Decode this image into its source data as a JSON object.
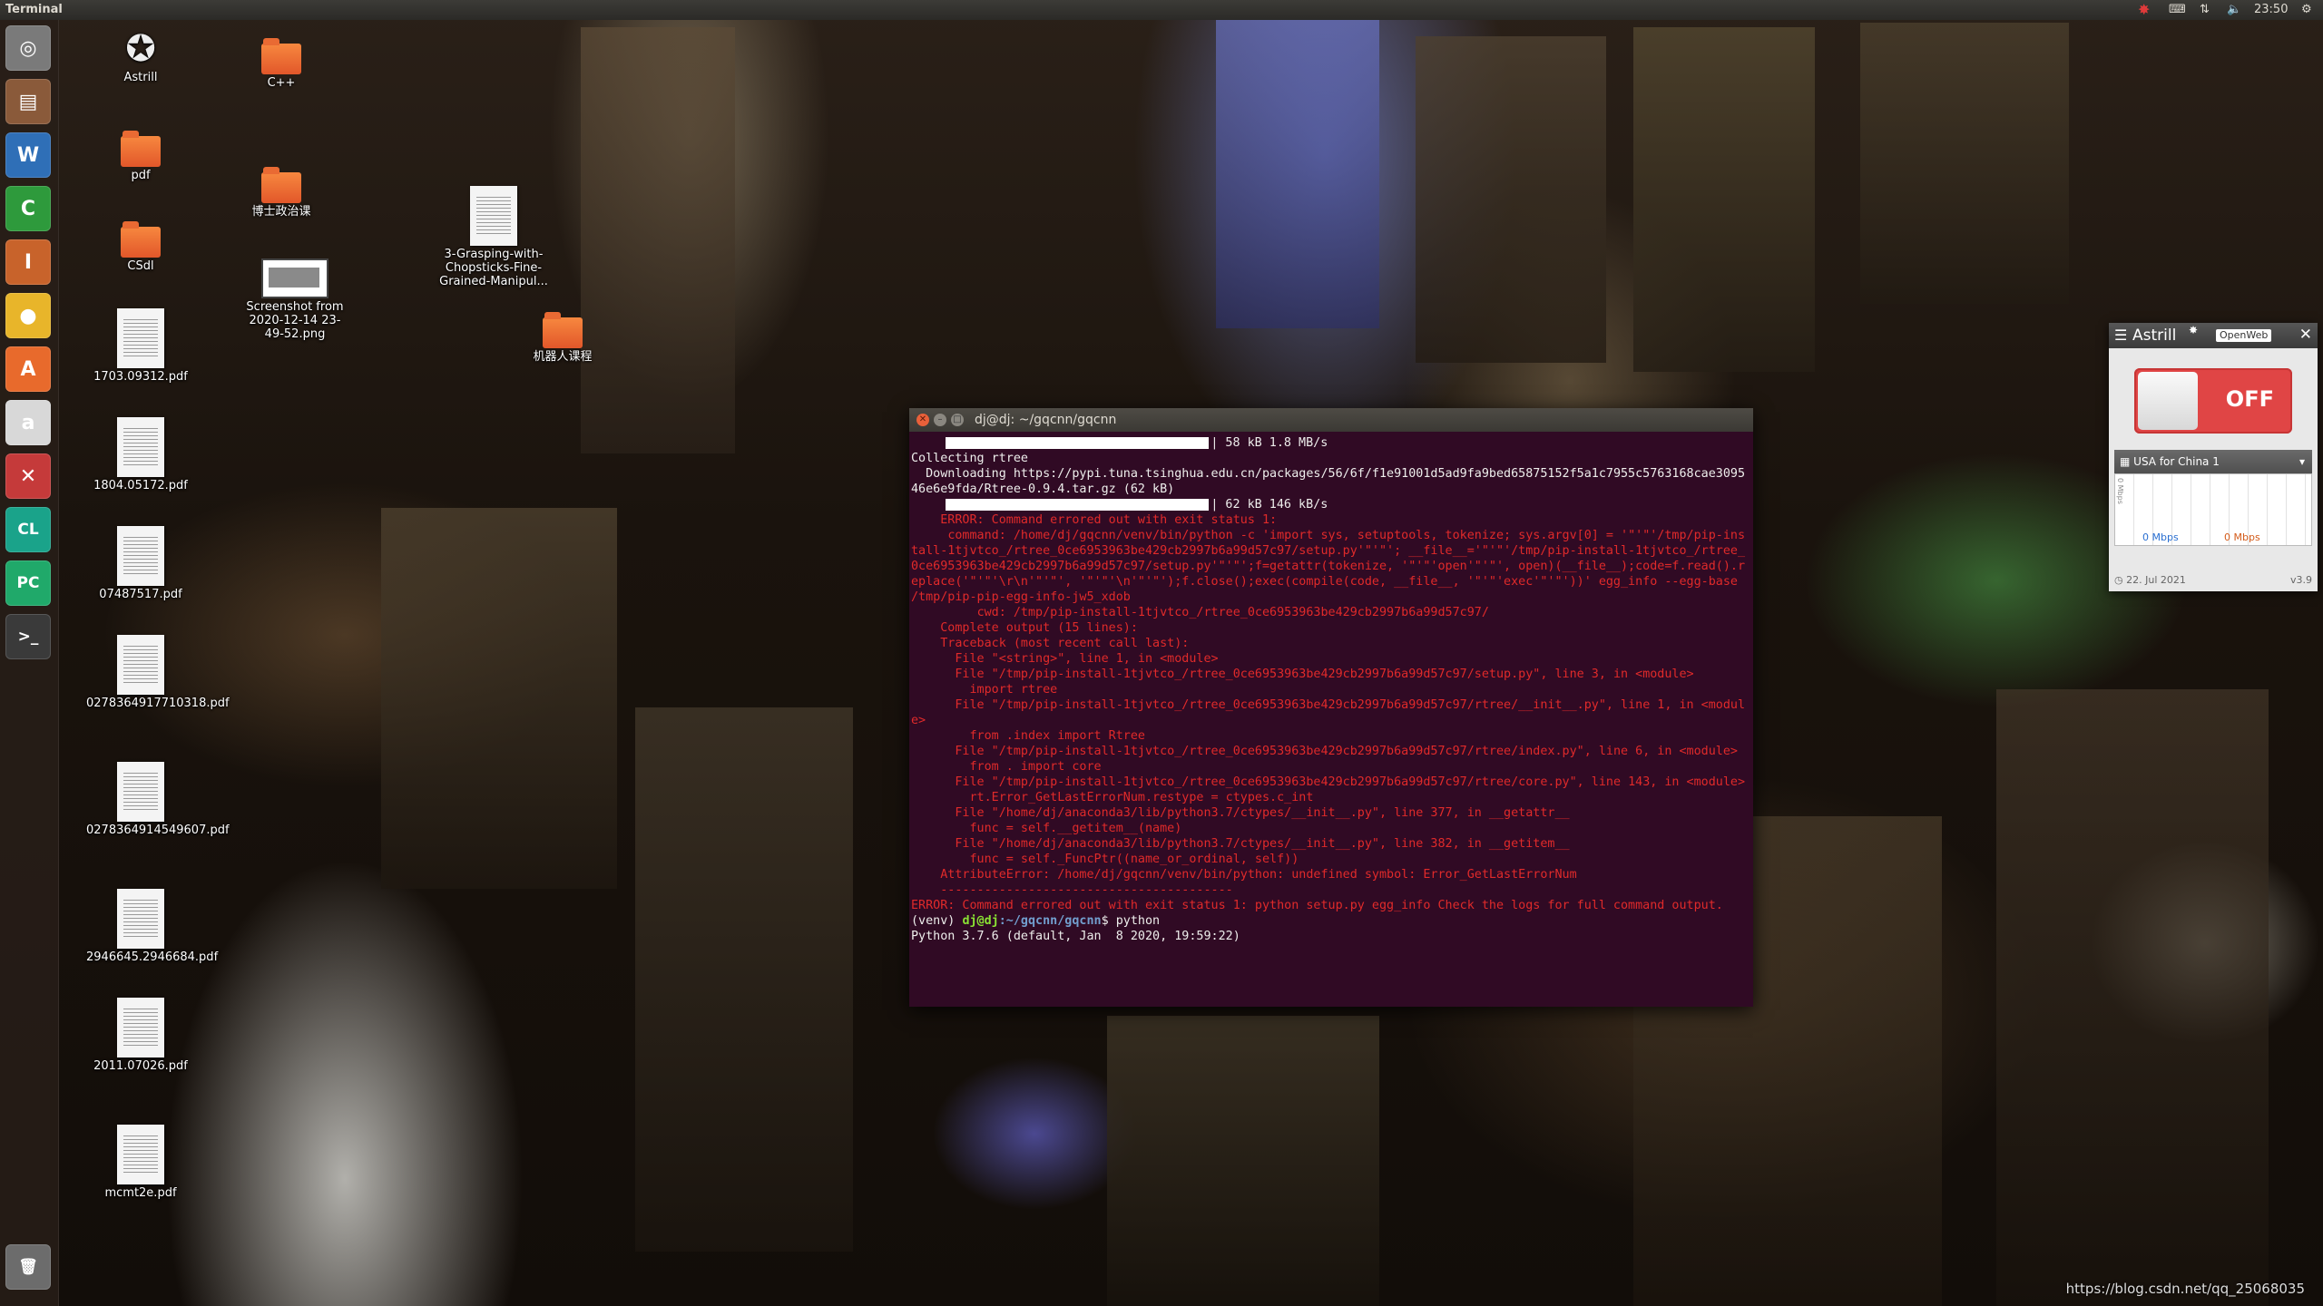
{
  "top_panel": {
    "title": "Terminal",
    "clock": "23:50",
    "tray_icons": [
      "astrill-tray-icon",
      "keyboard-icon",
      "network-icon",
      "volume-icon",
      "settings-gear-icon"
    ]
  },
  "launcher": {
    "items": [
      {
        "name": "ubuntu-dash-icon",
        "glyph": "◎",
        "color": "#7a7a7a"
      },
      {
        "name": "files-icon",
        "glyph": "▤",
        "color": "#8a5a3a"
      },
      {
        "name": "writer-icon",
        "glyph": "W",
        "color": "#2f6fb7"
      },
      {
        "name": "calc-icon",
        "glyph": "C",
        "color": "#2e9a3c"
      },
      {
        "name": "impress-icon",
        "glyph": "I",
        "color": "#c8632b"
      },
      {
        "name": "chrome-icon",
        "glyph": "●",
        "color": "#e8b52a"
      },
      {
        "name": "software-center-icon",
        "glyph": "A",
        "color": "#e86a2c"
      },
      {
        "name": "amazon-icon",
        "glyph": "a",
        "color": "#d8d8d8"
      },
      {
        "name": "system-settings-icon",
        "glyph": "✕",
        "color": "#c53a3a"
      },
      {
        "name": "clion-icon",
        "glyph": "CL",
        "color": "#1aa38a"
      },
      {
        "name": "pycharm-icon",
        "glyph": "PC",
        "color": "#20a96a"
      },
      {
        "name": "terminal-icon",
        "glyph": ">_",
        "color": "#3a3a3a"
      },
      {
        "name": "trash-icon",
        "glyph": "🗑",
        "color": "#6c6c6c"
      }
    ]
  },
  "desktop_icons": [
    {
      "name": "astrill-desktop-icon",
      "type": "astrill",
      "label": "Astrill"
    },
    {
      "name": "folder-cpp",
      "type": "folder",
      "label": "C++"
    },
    {
      "name": "folder-pdf",
      "type": "folder",
      "label": "pdf"
    },
    {
      "name": "folder-politics",
      "type": "folder",
      "label": "博士政治课"
    },
    {
      "name": "folder-csdl",
      "type": "folder",
      "label": "CSdl"
    },
    {
      "name": "screenshot-file",
      "type": "shot",
      "label": "Screenshot from 2020-12-14 23-49-52.png"
    },
    {
      "name": "grasping-file",
      "type": "doc",
      "label": "3-Grasping-with-Chopsticks-Fine-Grained-Manipul..."
    },
    {
      "name": "folder-robot",
      "type": "folder",
      "label": "机器人课程"
    },
    {
      "name": "pdf-1703",
      "type": "doc",
      "label": "1703.09312.pdf"
    },
    {
      "name": "pdf-1804",
      "type": "doc",
      "label": "1804.05172.pdf"
    },
    {
      "name": "pdf-07487",
      "type": "doc",
      "label": "07487517.pdf"
    },
    {
      "name": "pdf-0278-1",
      "type": "doc",
      "label": "0278364917710318.pdf"
    },
    {
      "name": "pdf-0278-2",
      "type": "doc",
      "label": "0278364914549607.pdf"
    },
    {
      "name": "pdf-2946",
      "type": "doc",
      "label": "2946645.2946684.pdf"
    },
    {
      "name": "pdf-2011",
      "type": "doc",
      "label": "2011.07026.pdf"
    },
    {
      "name": "pdf-mcmt",
      "type": "doc",
      "label": "mcmt2e.pdf"
    }
  ],
  "terminal": {
    "title": "dj@dj: ~/gqcnn/gqcnn",
    "lines": [
      {
        "bar": true,
        "text": "| 58 kB 1.8 MB/s",
        "style": "normal"
      },
      {
        "text": "Collecting rtree",
        "style": "normal"
      },
      {
        "text": "  Downloading https://pypi.tuna.tsinghua.edu.cn/packages/56/6f/f1e91001d5ad9fa9bed65875152f5a1c7955c5763168cae309546e6e9fda/Rtree-0.9.4.tar.gz (62 kB)",
        "style": "normal"
      },
      {
        "bar": true,
        "text": "| 62 kB 146 kB/s",
        "style": "normal"
      },
      {
        "text": "    ERROR: Command errored out with exit status 1:",
        "style": "err"
      },
      {
        "text": "     command: /home/dj/gqcnn/venv/bin/python -c 'import sys, setuptools, tokenize; sys.argv[0] = '\"'\"'/tmp/pip-install-1tjvtco_/rtree_0ce6953963be429cb2997b6a99d57c97/setup.py'\"'\"'; __file__='\"'\"'/tmp/pip-install-1tjvtco_/rtree_0ce6953963be429cb2997b6a99d57c97/setup.py'\"'\"';f=getattr(tokenize, '\"'\"'open'\"'\"', open)(__file__);code=f.read().replace('\"'\"'\\r\\n'\"'\"', '\"'\"'\\n'\"'\"');f.close();exec(compile(code, __file__, '\"'\"'exec'\"'\"'))' egg_info --egg-base /tmp/pip-pip-egg-info-jw5_xdob",
        "style": "err"
      },
      {
        "text": "         cwd: /tmp/pip-install-1tjvtco_/rtree_0ce6953963be429cb2997b6a99d57c97/",
        "style": "err"
      },
      {
        "text": "    Complete output (15 lines):",
        "style": "err"
      },
      {
        "text": "    Traceback (most recent call last):",
        "style": "err"
      },
      {
        "text": "      File \"<string>\", line 1, in <module>",
        "style": "err"
      },
      {
        "text": "      File \"/tmp/pip-install-1tjvtco_/rtree_0ce6953963be429cb2997b6a99d57c97/setup.py\", line 3, in <module>",
        "style": "err"
      },
      {
        "text": "        import rtree",
        "style": "err"
      },
      {
        "text": "      File \"/tmp/pip-install-1tjvtco_/rtree_0ce6953963be429cb2997b6a99d57c97/rtree/__init__.py\", line 1, in <module>",
        "style": "err"
      },
      {
        "text": "        from .index import Rtree",
        "style": "err"
      },
      {
        "text": "      File \"/tmp/pip-install-1tjvtco_/rtree_0ce6953963be429cb2997b6a99d57c97/rtree/index.py\", line 6, in <module>",
        "style": "err"
      },
      {
        "text": "        from . import core",
        "style": "err"
      },
      {
        "text": "      File \"/tmp/pip-install-1tjvtco_/rtree_0ce6953963be429cb2997b6a99d57c97/rtree/core.py\", line 143, in <module>",
        "style": "err"
      },
      {
        "text": "        rt.Error_GetLastErrorNum.restype = ctypes.c_int",
        "style": "err"
      },
      {
        "text": "      File \"/home/dj/anaconda3/lib/python3.7/ctypes/__init__.py\", line 377, in __getattr__",
        "style": "err"
      },
      {
        "text": "        func = self.__getitem__(name)",
        "style": "err"
      },
      {
        "text": "      File \"/home/dj/anaconda3/lib/python3.7/ctypes/__init__.py\", line 382, in __getitem__",
        "style": "err"
      },
      {
        "text": "        func = self._FuncPtr((name_or_ordinal, self))",
        "style": "err"
      },
      {
        "text": "    AttributeError: /home/dj/gqcnn/venv/bin/python: undefined symbol: Error_GetLastErrorNum",
        "style": "err"
      },
      {
        "text": "    ----------------------------------------",
        "style": "err"
      },
      {
        "text": "ERROR: Command errored out with exit status 1: python setup.py egg_info Check the logs for full command output.",
        "style": "err"
      },
      {
        "prompt": true,
        "venv": "(venv) ",
        "user": "dj@dj",
        "path": ":~/gqcnn/gqcnn",
        "cmd": "$ python",
        "style": "normal"
      },
      {
        "text": "Python 3.7.6 (default, Jan  8 2020, 19:59:22)",
        "style": "normal"
      }
    ]
  },
  "astrill": {
    "title": "Astrill",
    "mode": "OpenWeb",
    "toggle_state": "OFF",
    "server": "USA for China 1",
    "download": "0 Mbps",
    "upload": "0 Mbps",
    "graph_unit": "0 Mbps",
    "date": "22. Jul 2021",
    "version": "v3.9"
  },
  "watermark": "https://blog.csdn.net/qq_25068035"
}
